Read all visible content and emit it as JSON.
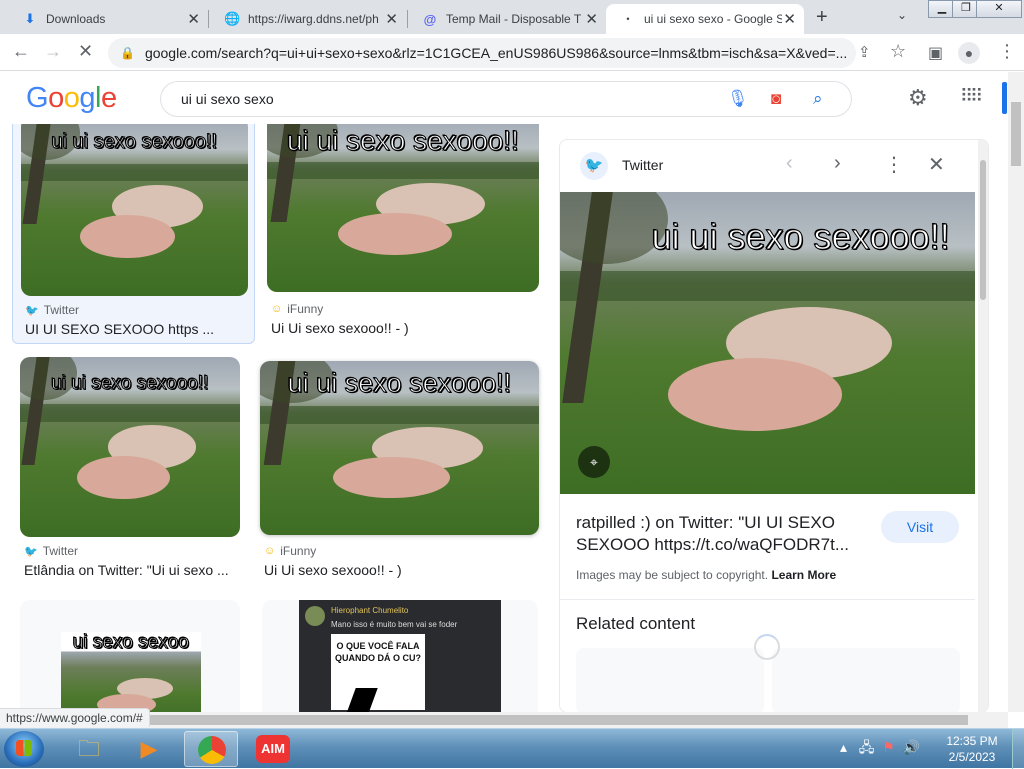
{
  "browser": {
    "tabs": [
      {
        "title": "Downloads",
        "icon": "download-icon"
      },
      {
        "title": "https://iwarg.ddns.net/ph",
        "icon": "globe-icon"
      },
      {
        "title": "Temp Mail - Disposable T",
        "icon": "at-icon"
      },
      {
        "title": "ui ui sexo sexo - Google S",
        "icon": "loading-dot"
      }
    ],
    "url": "google.com/search?q=ui+ui+sexo+sexo&rlz=1C1GCEA_enUS986US986&source=lnms&tbm=isch&sa=X&ved=...",
    "status_url": "https://www.google.com/#"
  },
  "google": {
    "logo": "Google",
    "query": "ui ui sexo sexo"
  },
  "results": [
    {
      "meme_text": "ui ui sexo sexooo!!",
      "source": "Twitter",
      "source_icon": "twitter-icon",
      "caption": "UI UI SEXO SEXOOO https ..."
    },
    {
      "meme_text": "ui ui sexo sexooo!!",
      "source": "iFunny",
      "source_icon": "ifunny-icon",
      "caption": "Ui Ui sexo sexooo!! - )"
    },
    {
      "meme_text": "ui ui sexo sexooo!!",
      "source": "Twitter",
      "source_icon": "twitter-icon",
      "caption": "Etlândia on Twitter: \"Ui ui sexo ..."
    },
    {
      "meme_text": "ui ui sexo sexooo!!",
      "source": "iFunny",
      "source_icon": "ifunny-icon",
      "caption": "Ui Ui sexo sexooo!! - )"
    },
    {
      "meme_text": "ui sexo sexoo"
    },
    {
      "header": "Hierophant Chumelito",
      "subtext": "Mano isso é muito bem vai se foder",
      "question": "O QUE VOCÊ FALA QUANDO DÁ O CU?"
    }
  ],
  "panel": {
    "source": "Twitter",
    "meme_text": "ui ui sexo sexooo!!",
    "title": "ratpilled :) on Twitter: \"UI UI SEXO SEXOOO https://t.co/waQFODR7t...",
    "visit_label": "Visit",
    "copyright": "Images may be subject to copyright.",
    "learn_more": "Learn More",
    "related_heading": "Related content"
  },
  "taskbar": {
    "time": "12:35 PM",
    "date": "2/5/2023"
  },
  "colors": {
    "google_blue": "#4285f4",
    "google_red": "#ea4335",
    "google_yellow": "#fbbc05",
    "google_green": "#34a853",
    "twitter_blue": "#1d9bf0",
    "link_blue": "#1a73e8"
  }
}
